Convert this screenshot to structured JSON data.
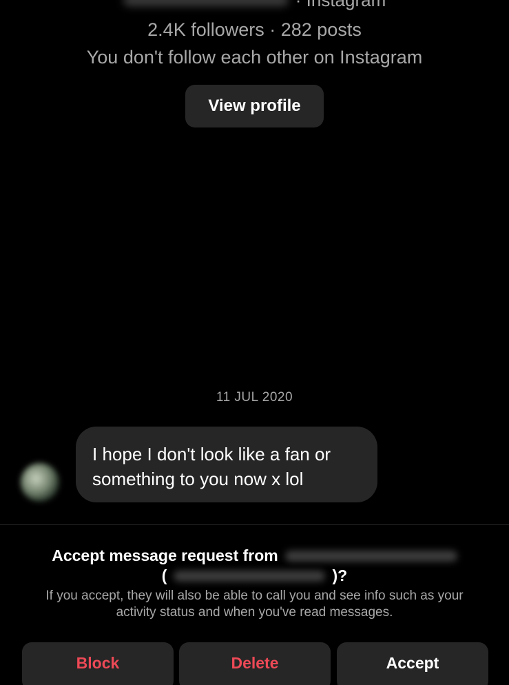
{
  "profile": {
    "source_label": "· Instagram",
    "stats": "2.4K followers · 282 posts",
    "follow_note": "You don't follow each other on Instagram",
    "view_profile_label": "View profile"
  },
  "conversation": {
    "date": "11 JUL 2020",
    "message_line1": "I hope I don't look like a fan or",
    "message_line2": "something to you now x lol"
  },
  "request": {
    "title_prefix": "Accept message request from",
    "open_paren": "(",
    "close_suffix": ")?",
    "description": "If you accept, they will also be able to call you and see info such as your activity status and when you've read messages."
  },
  "actions": {
    "block_label": "Block",
    "delete_label": "Delete",
    "accept_label": "Accept"
  },
  "colors": {
    "background": "#000000",
    "surface": "#262626",
    "secondary_text": "#a8a8a8",
    "danger": "#ed4956"
  }
}
